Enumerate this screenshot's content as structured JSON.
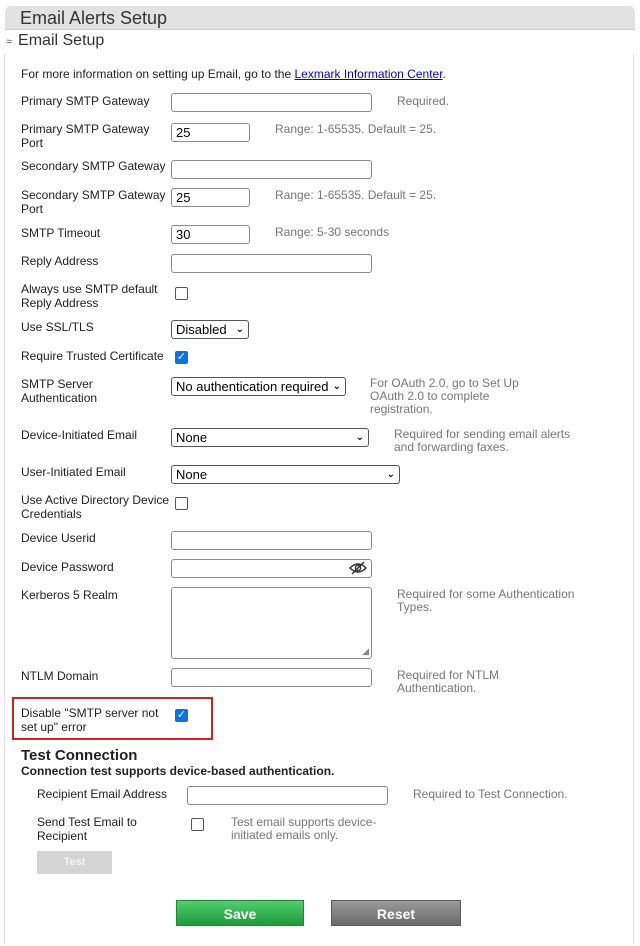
{
  "header": {
    "title": "Email Alerts Setup"
  },
  "section": {
    "title": "Email Setup"
  },
  "info": {
    "text": "For more information on setting up Email, go to the ",
    "link": "Lexmark Information Center",
    "suffix": "."
  },
  "fields": {
    "primary_gateway": {
      "label": "Primary SMTP Gateway",
      "value": "",
      "hint": "Required."
    },
    "primary_port": {
      "label_1": "Primary SMTP Gateway",
      "label_2": "Port",
      "value": "25",
      "hint": "Range: 1-65535. Default = 25."
    },
    "secondary_gateway": {
      "label": "Secondary SMTP Gateway",
      "value": ""
    },
    "secondary_port": {
      "label_1": "Secondary SMTP Gateway",
      "label_2": "Port",
      "value": "25",
      "hint": "Range: 1-65535. Default = 25."
    },
    "smtp_timeout": {
      "label": "SMTP Timeout",
      "value": "30",
      "hint": "Range: 5-30 seconds"
    },
    "reply_address": {
      "label": "Reply Address",
      "value": ""
    },
    "always_smtp_default": {
      "label_1": "Always use SMTP default",
      "label_2": "Reply Address",
      "checked": false
    },
    "ssl_tls": {
      "label": "Use SSL/TLS",
      "selected": "Disabled"
    },
    "trusted_cert": {
      "label": "Require Trusted Certificate",
      "checked": true
    },
    "server_auth": {
      "label_1": "SMTP Server",
      "label_2": "Authentication",
      "selected": "No authentication required",
      "hint_1": "For OAuth 2.0, go to Set Up",
      "hint_2": "OAuth 2.0 to complete",
      "hint_3": "registration."
    },
    "device_email": {
      "label": "Device-Initiated Email",
      "selected": "None",
      "hint_1": "Required for sending email alerts",
      "hint_2": "and forwarding faxes."
    },
    "user_email": {
      "label": "User-Initiated Email",
      "selected": "None"
    },
    "ad_credentials": {
      "label_1": "Use Active Directory Device",
      "label_2": "Credentials",
      "checked": false
    },
    "device_userid": {
      "label": "Device Userid",
      "value": ""
    },
    "device_password": {
      "label": "Device Password",
      "value": ""
    },
    "kerberos": {
      "label": "Kerberos 5 Realm",
      "value": "",
      "hint_1": "Required for some Authentication",
      "hint_2": "Types."
    },
    "ntlm": {
      "label": "NTLM Domain",
      "value": "",
      "hint_1": "Required for NTLM",
      "hint_2": "Authentication."
    },
    "disable_error": {
      "label_1": "Disable \"SMTP server not",
      "label_2": "set up\" error",
      "checked": true
    }
  },
  "test_connection": {
    "title": "Test Connection",
    "subtitle": "Connection test supports device-based authentication.",
    "recipient": {
      "label": "Recipient Email Address",
      "value": "",
      "hint": "Required to Test Connection."
    },
    "send_test": {
      "label_1": "Send Test Email to",
      "label_2": "Recipient",
      "checked": false,
      "hint_1": "Test email supports device-",
      "hint_2": "initiated emails only."
    },
    "test_button": "Test"
  },
  "actions": {
    "save": "Save",
    "reset": "Reset"
  },
  "colors": {
    "accent": "#0b73e6",
    "save": "#2fb34e",
    "reset": "#808080",
    "highlight": "#d42020"
  }
}
